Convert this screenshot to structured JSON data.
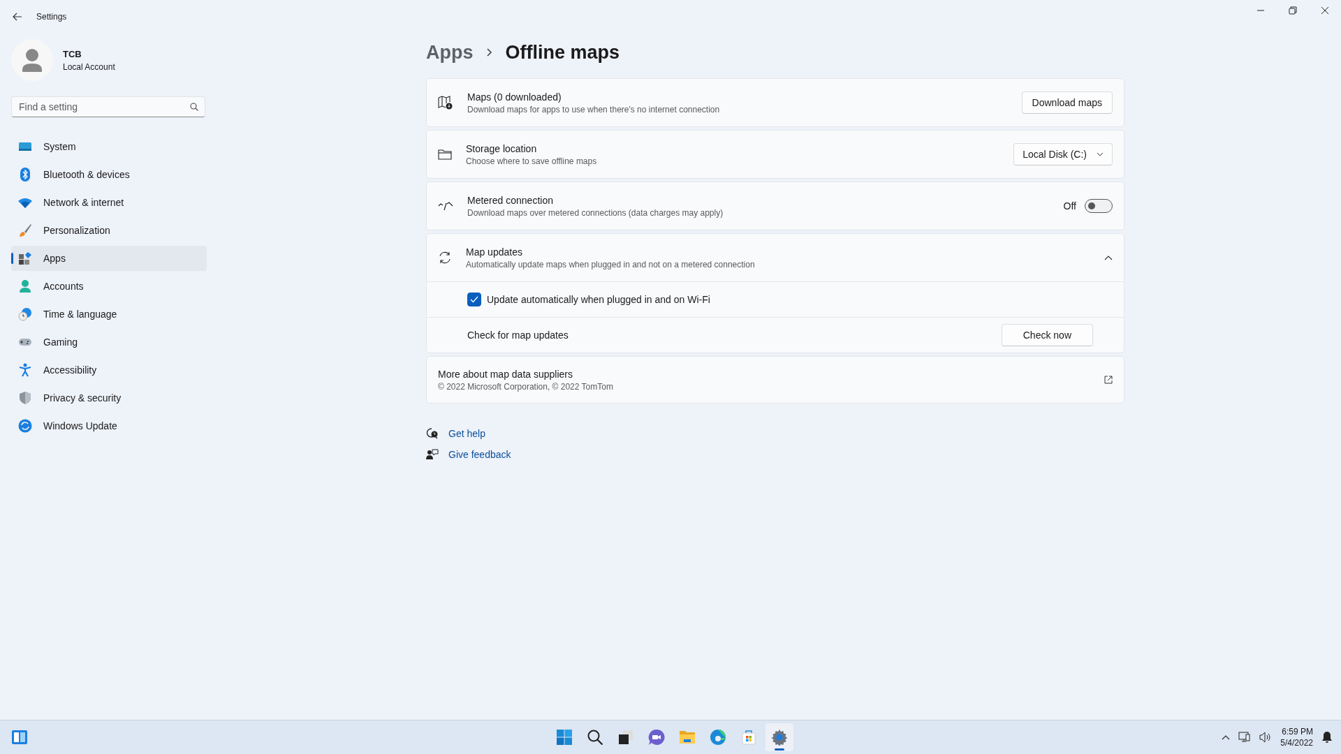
{
  "window": {
    "title": "Settings"
  },
  "account": {
    "name": "TCB",
    "type": "Local Account"
  },
  "search": {
    "placeholder": "Find a setting"
  },
  "nav": [
    {
      "label": "System",
      "selected": false
    },
    {
      "label": "Bluetooth & devices",
      "selected": false
    },
    {
      "label": "Network & internet",
      "selected": false
    },
    {
      "label": "Personalization",
      "selected": false
    },
    {
      "label": "Apps",
      "selected": true
    },
    {
      "label": "Accounts",
      "selected": false
    },
    {
      "label": "Time & language",
      "selected": false
    },
    {
      "label": "Gaming",
      "selected": false
    },
    {
      "label": "Accessibility",
      "selected": false
    },
    {
      "label": "Privacy & security",
      "selected": false
    },
    {
      "label": "Windows Update",
      "selected": false
    }
  ],
  "breadcrumb": {
    "parent": "Apps",
    "current": "Offline maps"
  },
  "settings": [
    {
      "kind": "button",
      "title": "Maps (0 downloaded)",
      "description": "Download maps for apps to use when there's no internet connection",
      "action": "Download maps"
    },
    {
      "kind": "dropdown",
      "title": "Storage location",
      "description": "Choose where to save offline maps",
      "value": "Local Disk (C:)"
    },
    {
      "kind": "toggle",
      "title": "Metered connection",
      "description": "Download maps over metered connections (data charges may apply)",
      "on": false,
      "state_label": "Off"
    },
    {
      "kind": "expander",
      "title": "Map updates",
      "description": "Automatically update maps when plugged in and not on a metered connection",
      "expanded": true,
      "children": [
        {
          "kind": "checkbox",
          "label": "Update automatically when plugged in and on Wi-Fi",
          "checked": true
        },
        {
          "kind": "button",
          "label": "Check for map updates",
          "action": "Check now"
        }
      ]
    },
    {
      "kind": "link",
      "title": "More about map data suppliers",
      "description": "© 2022 Microsoft Corporation, © 2022 TomTom"
    }
  ],
  "help_links": [
    {
      "label": "Get help"
    },
    {
      "label": "Give feedback"
    }
  ],
  "taskbar": {
    "apps": [
      {
        "selected": false
      },
      {
        "selected": false
      },
      {
        "selected": false
      },
      {
        "selected": false
      },
      {
        "selected": false
      },
      {
        "selected": false
      },
      {
        "selected": false
      },
      {
        "selected": true
      }
    ],
    "time": "6:59 PM",
    "date": "5/4/2022"
  }
}
